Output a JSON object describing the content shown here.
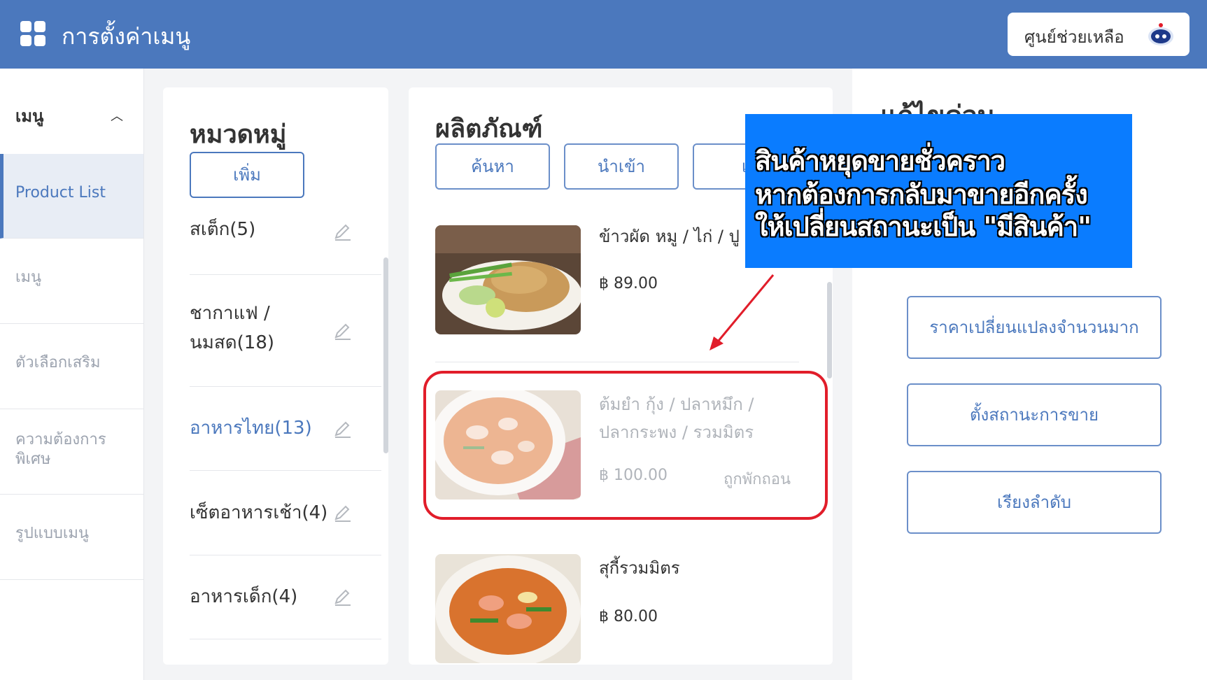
{
  "header": {
    "title": "การตั้งค่าเมนู",
    "help_label": "ศูนย์ช่วยเหลือ"
  },
  "sidebar": {
    "heading": "เมนู",
    "items": [
      {
        "label": "Product List"
      },
      {
        "label": "เมนู"
      },
      {
        "label": "ตัวเลือกเสริม"
      },
      {
        "label": "ความต้องการ พิเศษ"
      },
      {
        "label": "รูปแบบเมนู"
      }
    ]
  },
  "categories": {
    "title": "หมวดหมู่",
    "add_label": "เพิ่ม",
    "items": [
      {
        "label": "สเต็ก(5)"
      },
      {
        "label_line1": "ชากาแฟ /",
        "label_line2": "นมสด(18)"
      },
      {
        "label": "อาหารไทย(13)"
      },
      {
        "label": "เซ็ตอาหารเช้า(4)"
      },
      {
        "label": "อาหารเด็ก(4)"
      }
    ]
  },
  "products": {
    "title": "ผลิตภัณฑ์",
    "search_label": "ค้นหา",
    "import_label": "นำเข้า",
    "third_label": "เพ",
    "items": [
      {
        "name": "ข้าวผัด หมู / ไก่ / ปู",
        "price": "฿ 89.00"
      },
      {
        "name_line1": "ต้มยำ กุ้ง / ปลาหมึก /",
        "name_line2": "ปลากระพง / รวมมิตร",
        "price": "฿ 100.00",
        "status": "ถูกพักถอน"
      },
      {
        "name": "สุกี้รวมมิตร",
        "price": "฿ 80.00"
      }
    ]
  },
  "right_panel": {
    "title": "แก้ไขด่วน",
    "buttons": [
      {
        "label": "ราคาเปลี่ยนแปลงจำนวนมาก"
      },
      {
        "label": "ตั้งสถานะการขาย"
      },
      {
        "label": "เรียงลำดับ"
      }
    ]
  },
  "callout": {
    "line1": "สินค้าหยุดขายชั่วคราว",
    "line2": "หากต้องการกลับมาขายอีกครั้ง",
    "line3": "ให้เปลี่ยนสถานะเป็น \"มีสินค้า\""
  },
  "colors": {
    "primary": "#4b78bd",
    "callout_bg": "#0a7cff",
    "highlight": "#e11d2a"
  }
}
